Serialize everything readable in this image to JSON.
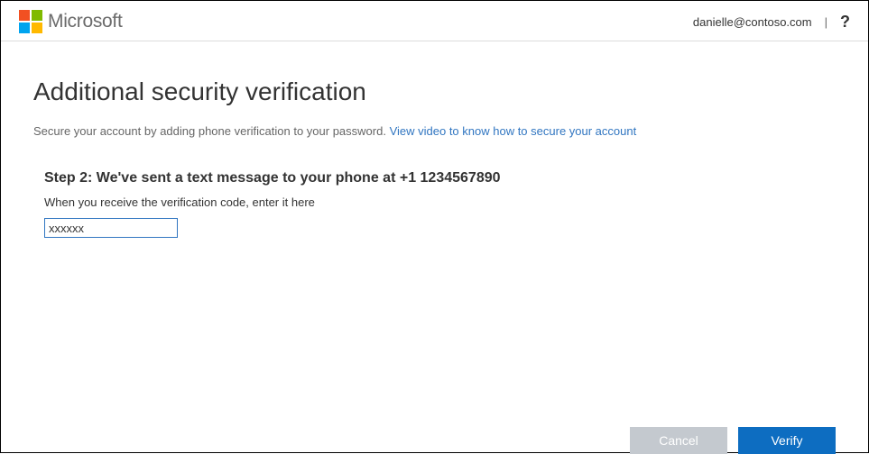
{
  "header": {
    "brand": "Microsoft",
    "user_email": "danielle@contoso.com",
    "separator": "|",
    "help": "?"
  },
  "page": {
    "title": "Additional security verification",
    "description_prefix": "Secure your account by adding phone verification to your password. ",
    "video_link_text": "View video to know how to secure your account"
  },
  "step": {
    "title": "Step 2: We've sent a text message to your phone at  +1 1234567890",
    "instruction": "When you receive the verification code, enter it here",
    "code_value": "xxxxxx"
  },
  "buttons": {
    "cancel": "Cancel",
    "verify": "Verify"
  }
}
